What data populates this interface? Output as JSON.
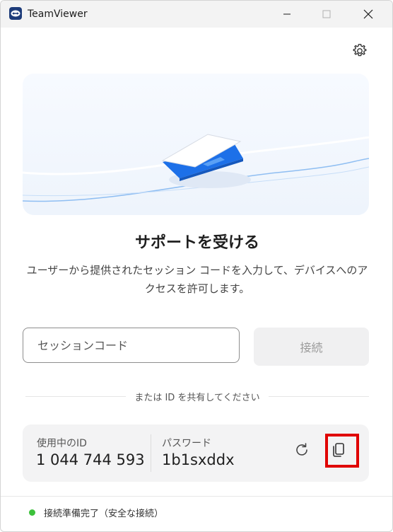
{
  "window": {
    "title": "TeamViewer"
  },
  "main": {
    "heading": "サポートを受ける",
    "description": "ユーザーから提供されたセッション コードを入力して、デバイスへのアクセスを許可します。"
  },
  "session": {
    "placeholder": "セッションコード",
    "value": "",
    "connect_label": "接続"
  },
  "divider": {
    "text": "または ID を共有してください"
  },
  "credentials": {
    "id_label": "使用中のID",
    "id_value": "1 044 744 593",
    "password_label": "パスワード",
    "password_value": "1b1sxddx"
  },
  "status": {
    "text": "接続準備完了（安全な接続）",
    "color": "#3cc13b"
  },
  "colors": {
    "accent_blue": "#1d70e8",
    "highlight_red": "#e00000"
  },
  "icons": {
    "app": "teamviewer-logo-icon",
    "settings": "gear-icon",
    "refresh": "refresh-icon",
    "copy": "copy-icon"
  }
}
